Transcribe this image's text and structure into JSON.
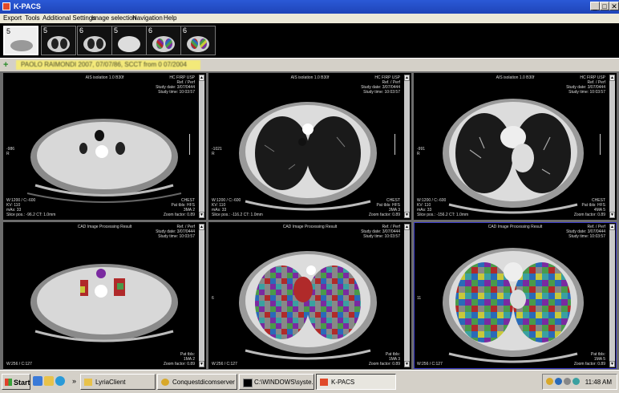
{
  "window": {
    "title": "K-PACS",
    "controls": {
      "minimize": "_",
      "maximize": "□",
      "close": "✕"
    }
  },
  "menu": [
    "Export",
    "Tools",
    "Additional Settings",
    "Image selection",
    "Navigation",
    "Help"
  ],
  "thumbnails": [
    "5",
    "5",
    "6",
    "5",
    "6",
    "6"
  ],
  "patient_bar": {
    "icon": "+",
    "label": "PAOLO RAIMONDI 2007, 07/07/86, SCCT  from 0 07/2004"
  },
  "viewports": [
    {
      "top_left": [
        "",
        "",
        "",
        ""
      ],
      "top_center": "AIS isolation 1.0 B30f",
      "top_right": [
        "HC FIRP USP",
        "Ref. / Perf",
        "Study date: 3/07/0444",
        "Study time: 10:03:57"
      ],
      "mid_left": [
        "-986",
        "R"
      ],
      "bottom_left": [
        "W:1200 / C:-600",
        "KV: 110",
        "mAs: 33",
        "Slice pos.: -96.2 CT: 1.0mm"
      ],
      "bottom_right": [
        "CHEST",
        "Pat tbls: HFS",
        "3MA 2",
        "Zoom factor: 0.89"
      ]
    },
    {
      "top_left": [
        "",
        "",
        ""
      ],
      "top_center": "AIS isolation 1.0 B30f",
      "top_right": [
        "HC FIRP USP",
        "Ref. / Perf",
        "Study date: 3/07/0444",
        "Study time: 10:03:57"
      ],
      "mid_left": [
        "-1021",
        "R"
      ],
      "bottom_left": [
        "W:1200 / C:-600",
        "KV: 110",
        "mAs: 33",
        "Slice pos.: -116.2 CT: 1.0mm"
      ],
      "bottom_right": [
        "CHEST",
        "Pat tbls: HFS",
        "3MA 3",
        "Zoom factor: 0.89"
      ]
    },
    {
      "top_left": [
        "",
        "",
        ""
      ],
      "top_center": "AIS isolation 1.0 B30f",
      "top_right": [
        "HC FIRP USP",
        "Ref. / Perf",
        "Study date: 3/07/0444",
        "Study time: 10:03:57"
      ],
      "mid_left": [
        "-991",
        "R"
      ],
      "bottom_left": [
        "W:1200 / C:-600",
        "KV: 110",
        "mAs: 33",
        "Slice pos.: -156.2 CT: 1.0mm"
      ],
      "bottom_right": [
        "CHEST",
        "Pat tbls: HFS",
        "4MA 5",
        "Zoom factor: 0.89"
      ]
    },
    {
      "top_left": [
        "",
        "",
        ""
      ],
      "top_center": "CAD Image Processing Result",
      "top_right": [
        "Ref. / Perf",
        "Study date: 3/07/0444",
        "Study time: 10:03:57"
      ],
      "mid_left": [
        "",
        ""
      ],
      "bottom_left": [
        "W:256 / C:127"
      ],
      "bottom_right": [
        "Pat tbls:",
        "1MA 2",
        "Zoom factor: 0.89"
      ]
    },
    {
      "top_left": [
        "",
        "",
        ""
      ],
      "top_center": "CAD Image Processing Result",
      "top_right": [
        "Ref. / Perf",
        "Study date: 3/07/0444",
        "Study time: 10:03:57"
      ],
      "mid_left": [
        "6",
        ""
      ],
      "bottom_left": [
        "W:256 / C:127"
      ],
      "bottom_right": [
        "Pat tbls:",
        "1MA 3",
        "Zoom factor: 0.89"
      ]
    },
    {
      "top_left": [
        "",
        "",
        ""
      ],
      "top_center": "CAD Image Processing Result",
      "top_right": [
        "Ref. / Perf",
        "Study date: 3/07/0444",
        "Study time: 10:03:57"
      ],
      "mid_left": [
        "11",
        ""
      ],
      "bottom_left": [
        "W:256 / C:127"
      ],
      "bottom_right": [
        "Pat tbls:",
        "1MA 5",
        "Zoom factor: 0.89"
      ]
    }
  ],
  "taskbar": {
    "start_label": "Start",
    "overflow": "»",
    "tasks": [
      "LyriaClient",
      "Conquestdicomserver",
      "C:\\WINDOWS\\syste...",
      "K-PACS"
    ],
    "clock": "11:48 AM"
  },
  "colors": {
    "title_bar": "#2a59d6",
    "cad_classes": [
      "#4a9a4a",
      "#b02a2a",
      "#7a2aa0",
      "#2a6ab8",
      "#c8c83a",
      "#888888",
      "#3aa0a0"
    ]
  }
}
